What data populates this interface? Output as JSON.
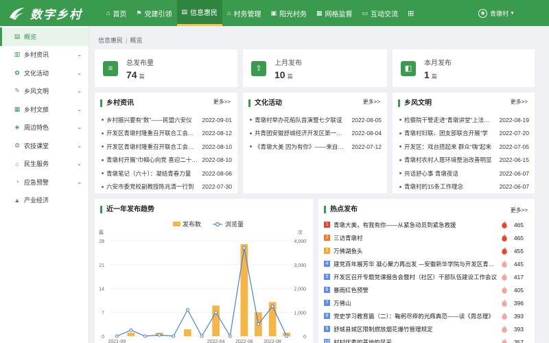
{
  "app": {
    "title": "数字乡村"
  },
  "nav": {
    "items": [
      {
        "label": "首页",
        "icon": "home-icon"
      },
      {
        "label": "党建引领",
        "icon": "flag-icon"
      },
      {
        "label": "信息惠民",
        "icon": "document-icon",
        "active": true
      },
      {
        "label": "村务管理",
        "icon": "bank-icon"
      },
      {
        "label": "阳光村务",
        "icon": "bulletin-icon"
      },
      {
        "label": "网格监督",
        "icon": "grid-icon"
      },
      {
        "label": "互动交流",
        "icon": "chat-icon"
      },
      {
        "label": "",
        "icon": "apps-icon"
      }
    ],
    "user": "青墩村"
  },
  "sidebar": {
    "items": [
      {
        "label": "概览",
        "icon": "overview-icon",
        "active": true,
        "chevron": false
      },
      {
        "label": "乡村资讯",
        "icon": "news-icon",
        "chevron": true
      },
      {
        "label": "文化活动",
        "icon": "culture-icon",
        "chevron": true
      },
      {
        "label": "乡风文明",
        "icon": "civility-icon",
        "chevron": true
      },
      {
        "label": "乡村文旅",
        "icon": "tourism-icon",
        "chevron": true
      },
      {
        "label": "周边特色",
        "icon": "feature-icon",
        "chevron": true
      },
      {
        "label": "农技课堂",
        "icon": "class-icon",
        "chevron": true
      },
      {
        "label": "民生服务",
        "icon": "service-icon",
        "chevron": true
      },
      {
        "label": "应急预警",
        "icon": "alert-icon",
        "chevron": true
      },
      {
        "label": "产业经济",
        "icon": "economy-icon",
        "chevron": false
      }
    ]
  },
  "breadcrumb": {
    "parent": "信息惠民",
    "current": "概览"
  },
  "stats": [
    {
      "label": "总发布量",
      "value": "74",
      "unit": "篇",
      "icon": "list-icon"
    },
    {
      "label": "上月发布",
      "value": "10",
      "unit": "篇",
      "icon": "upload-icon"
    },
    {
      "label": "本月发布",
      "value": "1",
      "unit": "篇",
      "icon": "book-icon"
    }
  ],
  "panels": {
    "news": {
      "title": "乡村资讯",
      "more": "更多>>",
      "items": [
        {
          "title": "乡村振兴要有“数”——民盟六安仪",
          "date": "2022-09-01"
        },
        {
          "title": "开发区青墩村隆重召开联合工会会员",
          "date": "2022-08-12"
        },
        {
          "title": "开发区青墩村隆重召开联合工会会员",
          "date": "2022-08-10"
        },
        {
          "title": "青墩村开展“巾帼心向党 喜迎二十大”",
          "date": "2022-08-10"
        },
        {
          "title": "青墩笔记（六十）：凝结青春力量",
          "date": "2022-08-06"
        },
        {
          "title": "六安市委党校副教授陈兆清一行到",
          "date": "2022-07-30"
        }
      ]
    },
    "culture": {
      "title": "文化活动",
      "more": "更多>>",
      "items": [
        {
          "title": "青墩村举办花船队首演暨七夕联谊",
          "date": "2022-08-05"
        },
        {
          "title": "共青团安徽舒城经济开发区第一次团员",
          "date": "2022-08-04"
        },
        {
          "title": "《青墩大美 因为有你》——来自青墩",
          "date": "2022-07-12"
        }
      ]
    },
    "civility": {
      "title": "乡风文明",
      "more": "更多>>",
      "items": [
        {
          "title": "检察院干警走进“青墩讲堂”上法治课",
          "date": "2022-08-19"
        },
        {
          "title": "青墩村妇联、团支部联合开展“学",
          "date": "2022-07-20"
        },
        {
          "title": "开发区：戏台搭起来 群众“嗨”起来",
          "date": "2022-07-05"
        },
        {
          "title": "青墩村农村人居环境整治改善明显",
          "date": "2022-06-15"
        },
        {
          "title": "共话舒心事 青墩夜话",
          "date": "2022-06-07"
        },
        {
          "title": "青墩村的15条工作理念",
          "date": "2022-06-07"
        }
      ]
    },
    "trend": {
      "title": "近一年发布趋势"
    },
    "hot": {
      "title": "热点发布",
      "more": "更多>>",
      "items": [
        {
          "rank": "1",
          "color": "#e8432e",
          "title": "青墩大美，有我有你——从紧急动员到紧急救援",
          "count": "465"
        },
        {
          "rank": "2",
          "color": "#f07a2b",
          "title": "三访青墩村",
          "count": "465"
        },
        {
          "rank": "3",
          "color": "#f5a623",
          "title": "万佛湖鱼头",
          "count": "455"
        },
        {
          "rank": "4",
          "color": "#5b8def",
          "title": "建党百年展芳华 凝心聚力再出发 —安徽新华学院与开发区青墩村",
          "count": "445"
        },
        {
          "rank": "5",
          "color": "#5b8def",
          "title": "开发区召开专题党课报告会暨村（社区）干部队伍建设工作会议",
          "count": "417"
        },
        {
          "rank": "6",
          "color": "#5b8def",
          "title": "暴雨红色预警",
          "count": "405"
        },
        {
          "rank": "7",
          "color": "#5b8def",
          "title": "万佛山",
          "count": "396"
        },
        {
          "rank": "8",
          "color": "#5b8def",
          "title": "党史学习教育篇（二）：鞠躬尽瘁的光辉典范——读《周总理》",
          "count": "393"
        },
        {
          "rank": "9",
          "color": "#5b8def",
          "title": "舒城县城区限制燃放烟花爆竹管理规定",
          "count": "393"
        },
        {
          "rank": "10",
          "color": "#5b8def",
          "title": "村村优秀的基地的风采",
          "count": "357"
        }
      ]
    }
  },
  "chart_data": {
    "type": "bar",
    "title": "近一年发布趋势",
    "legend": [
      "发布数",
      "浏览量"
    ],
    "left_axis_unit": "篇",
    "right_axis_unit": "次",
    "categories": [
      "2021-09",
      "2021-10",
      "2021-11",
      "2021-12",
      "2022-01",
      "2022-02",
      "2022-03",
      "2022-04",
      "2022-05",
      "2022-06",
      "2022-07",
      "2022-08",
      "2022-09"
    ],
    "x_tick_labels": [
      "2021-09",
      "2022-04",
      "2022-06",
      "2022-08"
    ],
    "series": [
      {
        "name": "发布数",
        "type": "bar",
        "axis": "left",
        "values": [
          0,
          1,
          0,
          1,
          0,
          2,
          0,
          9,
          0,
          27,
          7,
          10,
          1
        ]
      },
      {
        "name": "浏览量",
        "type": "line",
        "axis": "right",
        "values": [
          0,
          250,
          0,
          50,
          0,
          1100,
          0,
          1000,
          0,
          3700,
          500,
          1250,
          0
        ]
      }
    ],
    "left_ylim": [
      0,
      28
    ],
    "left_ticks": [
      0,
      7,
      14,
      21,
      28
    ],
    "right_ylim": [
      0,
      4000
    ],
    "right_ticks": [
      "0",
      "1,000",
      "2,000",
      "3,000",
      "4,000"
    ],
    "bar_color": "#f5b547",
    "line_color": "#4a7fd6"
  }
}
